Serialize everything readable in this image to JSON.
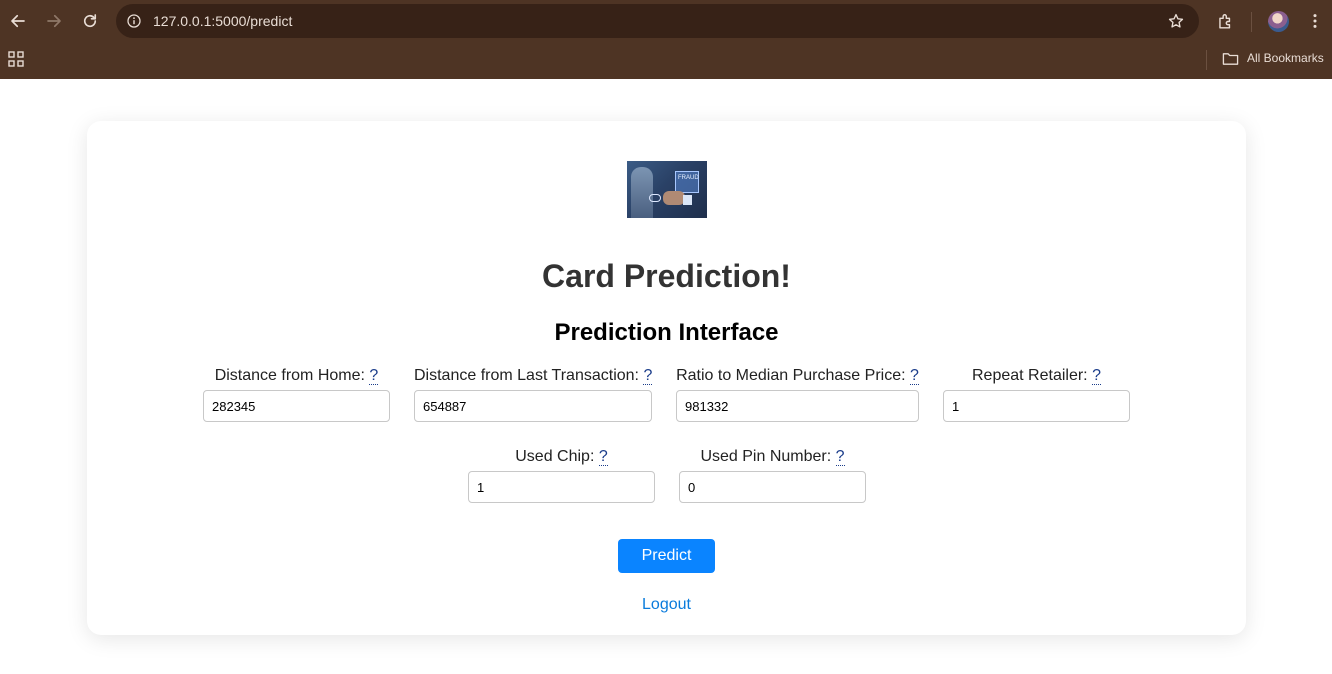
{
  "browser": {
    "url": "127.0.0.1:5000/predict",
    "bookmarks_folder_label": "All Bookmarks"
  },
  "page": {
    "logo_text": "FRAUD",
    "title": "Card Prediction!",
    "subtitle": "Prediction Interface",
    "help_mark": "?",
    "fields": [
      {
        "label": "Distance from Home:",
        "value": "282345"
      },
      {
        "label": "Distance from Last Transaction:",
        "value": "654887"
      },
      {
        "label": "Ratio to Median Purchase Price:",
        "value": "981332"
      },
      {
        "label": "Repeat Retailer:",
        "value": "1"
      },
      {
        "label": "Used Chip:",
        "value": "1"
      },
      {
        "label": "Used Pin Number:",
        "value": "0"
      }
    ],
    "predict_label": "Predict",
    "logout_label": "Logout"
  },
  "colors": {
    "chrome": "#4e3424",
    "omnibox": "#372217",
    "primary_button": "#0a84ff",
    "link": "#0a7bdc"
  }
}
